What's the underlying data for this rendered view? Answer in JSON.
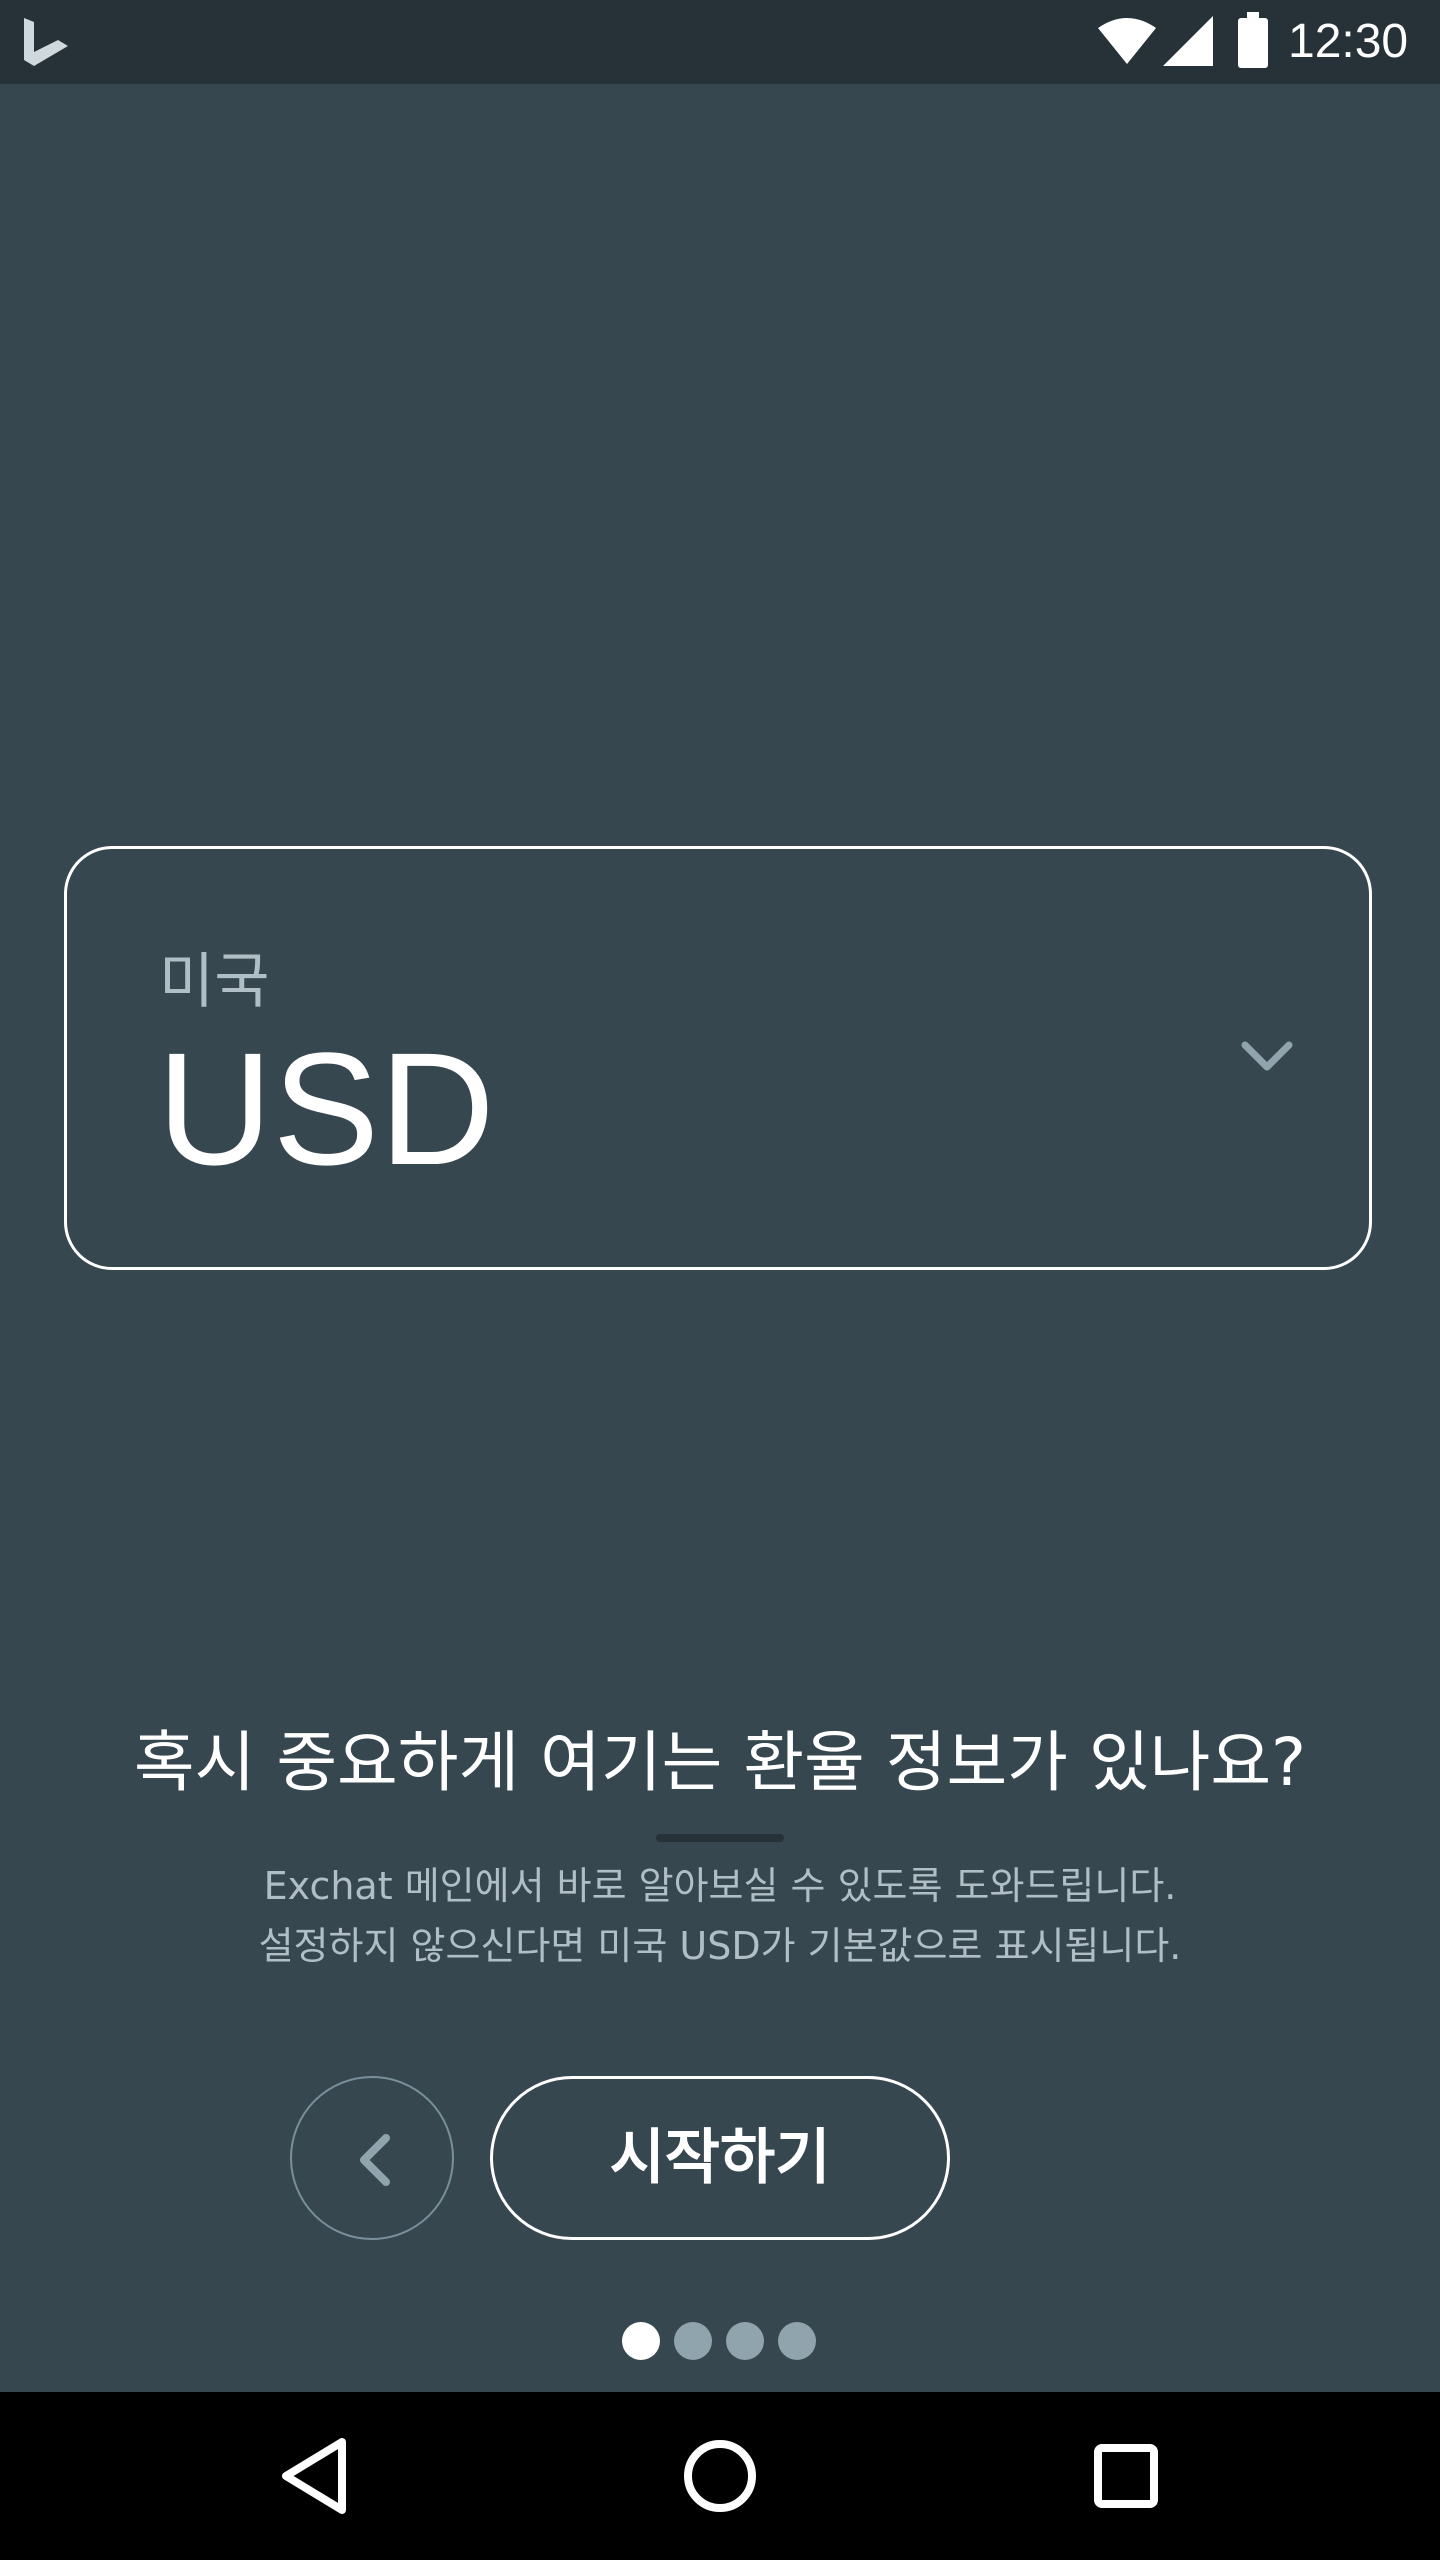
{
  "status_bar": {
    "time": "12:30",
    "icons": [
      "bing-logo-icon",
      "wifi-icon",
      "signal-icon",
      "battery-icon"
    ]
  },
  "currency_selector": {
    "country": "미국",
    "code": "USD",
    "icon": "chevron-down-icon"
  },
  "onboarding": {
    "question": "혹시 중요하게 여기는 환율 정보가 있나요?",
    "description_line1": "Exchat 메인에서 바로 알아보실 수 있도록 도와드립니다.",
    "description_line2": "설정하지 않으신다면 미국 USD가 기본값으로 표시됩니다."
  },
  "actions": {
    "back_icon": "chevron-left-icon",
    "start_label": "시작하기"
  },
  "pager": {
    "total_pages": 4,
    "current_page": 1
  },
  "nav_bar": {
    "icons": [
      "back-triangle-icon",
      "home-circle-icon",
      "recents-square-icon"
    ]
  },
  "colors": {
    "background": "#37474f",
    "status_bar": "#263238",
    "accent": "#ffffff",
    "muted_text": "#b0bec5"
  }
}
